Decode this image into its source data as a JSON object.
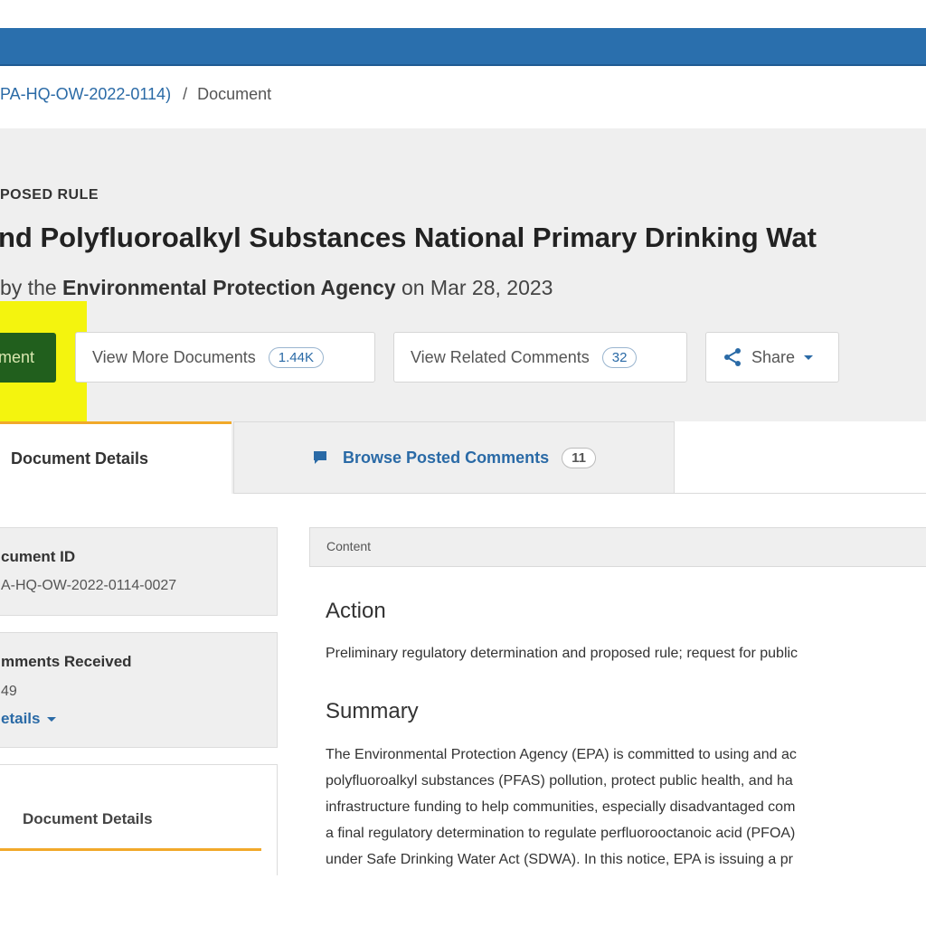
{
  "breadcrumb": {
    "docket_link": "PA-HQ-OW-2022-0114)",
    "separator": "/",
    "current": "Document"
  },
  "document": {
    "type_label": "POSED RULE",
    "title": "nd Polyfluoroalkyl Substances National Primary Drinking Wat",
    "byline_prefix": "by the",
    "agency": "Environmental Protection Agency",
    "byline_on": "on",
    "date": "Mar 28, 2023"
  },
  "actions": {
    "comment_label": "ment",
    "view_more_documents_label": "View More Documents",
    "view_more_documents_count": "1.44K",
    "view_related_comments_label": "View Related Comments",
    "view_related_comments_count": "32",
    "share_label": "Share",
    "highlight_color": "#f4f40e",
    "primary_color": "#215f1d"
  },
  "tabs": {
    "document_details": "Document Details",
    "browse_comments": "Browse Posted Comments",
    "browse_comments_count": "11",
    "active_accent": "#f1a92a"
  },
  "sidebar": {
    "document_id_label": "cument ID",
    "document_id_value": "A-HQ-OW-2022-0114-0027",
    "comments_received_label": "mments Received",
    "comments_received_value": "49",
    "view_details_label": "etails",
    "details_tab_label": "Document Details"
  },
  "content": {
    "header": "Content",
    "action_heading": "Action",
    "action_text": "Preliminary regulatory determination and proposed rule; request for public",
    "summary_heading": "Summary",
    "summary_lines": [
      "The Environmental Protection Agency (EPA) is committed to using and ac",
      "polyfluoroalkyl substances (PFAS) pollution, protect public health, and ha",
      "infrastructure funding to help communities, especially disadvantaged com",
      "a final regulatory determination to regulate perfluorooctanoic acid (PFOA)",
      "under Safe Drinking Water Act (SDWA). In this notice, EPA is issuing a pr"
    ]
  },
  "icons": {
    "share": "share-icon",
    "comment": "comment-icon",
    "caret": "caret-down-icon"
  }
}
